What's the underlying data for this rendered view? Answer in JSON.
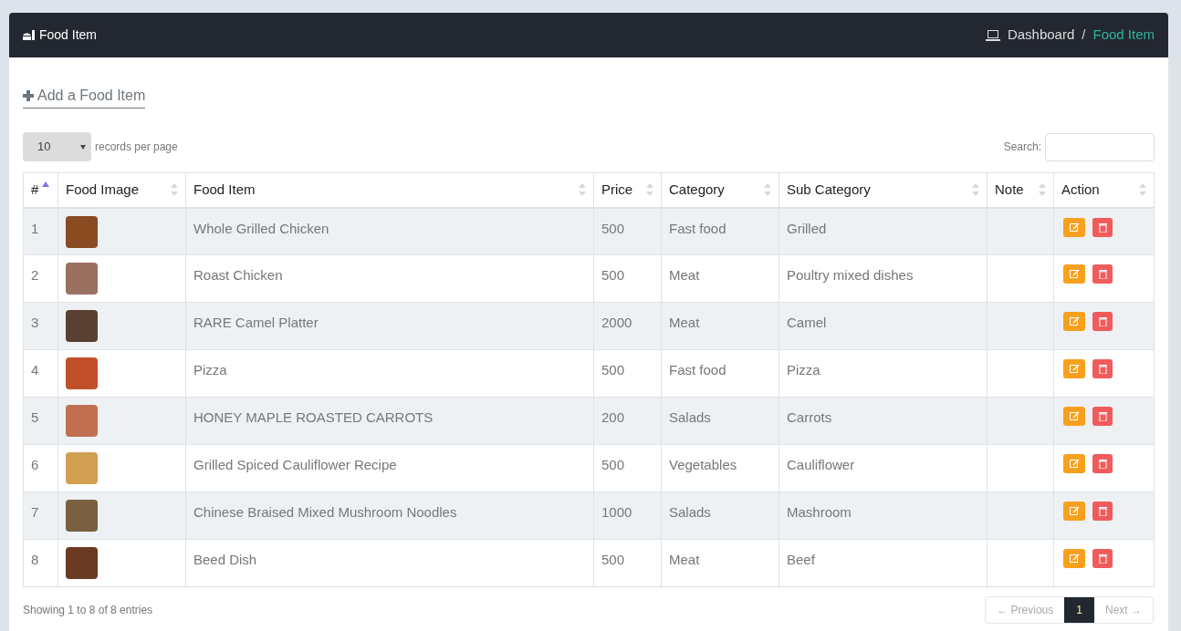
{
  "header": {
    "title": "Food Item",
    "separator": "/",
    "breadcrumb": [
      {
        "label": "Dashboard",
        "current": false
      },
      {
        "label": "Food Item",
        "current": true
      }
    ]
  },
  "add_link": "Add a Food Item",
  "page_size": {
    "value": "10",
    "label": "records per page"
  },
  "search": {
    "label": "Search:"
  },
  "table": {
    "columns": [
      {
        "label": "#",
        "sorted": true
      },
      {
        "label": "Food Image",
        "sorted": false
      },
      {
        "label": "Food Item",
        "sorted": false
      },
      {
        "label": "Price",
        "sorted": false
      },
      {
        "label": "Category",
        "sorted": false
      },
      {
        "label": "Sub Category",
        "sorted": false
      },
      {
        "label": "Note",
        "sorted": false
      },
      {
        "label": "Action",
        "sorted": false
      }
    ],
    "rows": [
      {
        "num": "1",
        "item": "Whole Grilled Chicken",
        "price": "500",
        "category": "Fast food",
        "sub_category": "Grilled"
      },
      {
        "num": "2",
        "item": "Roast Chicken",
        "price": "500",
        "category": "Meat",
        "sub_category": "Poultry mixed dishes"
      },
      {
        "num": "3",
        "item": "RARE Camel Platter",
        "price": "2000",
        "category": "Meat",
        "sub_category": "Camel"
      },
      {
        "num": "4",
        "item": "Pizza",
        "price": "500",
        "category": "Fast food",
        "sub_category": "Pizza"
      },
      {
        "num": "5",
        "item": "HONEY MAPLE ROASTED CARROTS",
        "price": "200",
        "category": "Salads",
        "sub_category": "Carrots"
      },
      {
        "num": "6",
        "item": "Grilled Spiced Cauliflower Recipe",
        "price": "500",
        "category": "Vegetables",
        "sub_category": "Cauliflower"
      },
      {
        "num": "7",
        "item": "Chinese Braised Mixed Mushroom Noodles",
        "price": "1000",
        "category": "Salads",
        "sub_category": "Mashroom"
      },
      {
        "num": "8",
        "item": "Beed Dish",
        "price": "500",
        "category": "Meat",
        "sub_category": "Beef"
      }
    ]
  },
  "footer": {
    "info": "Showing 1 to 8 of 8 entries",
    "previous": {
      "label": "← Previous",
      "disabled": true
    },
    "pages": [
      {
        "label": "1",
        "selected": true
      }
    ],
    "next": {
      "label": "Next →",
      "disabled": true
    }
  }
}
